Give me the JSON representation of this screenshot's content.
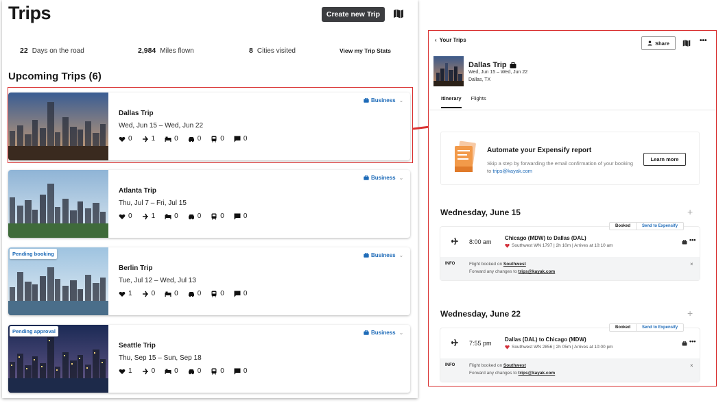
{
  "left": {
    "title": "Trips",
    "create_label": "Create new Trip",
    "stats": [
      {
        "value": "22",
        "label": "Days on the road"
      },
      {
        "value": "2,984",
        "label": "Miles flown"
      },
      {
        "value": "8",
        "label": "Cities visited"
      }
    ],
    "stats_link": "View my Trip Stats",
    "upcoming_title": "Upcoming Trips (6)",
    "trips": [
      {
        "name": "Dallas Trip",
        "dates": "Wed, Jun 15 – Wed, Jun 22",
        "tag": "Business",
        "badge": "",
        "counts": [
          "0",
          "1",
          "0",
          "0",
          "0",
          "0"
        ]
      },
      {
        "name": "Atlanta Trip",
        "dates": "Thu, Jul 7 – Fri, Jul 15",
        "tag": "Business",
        "badge": "",
        "counts": [
          "0",
          "1",
          "0",
          "0",
          "0",
          "0"
        ]
      },
      {
        "name": "Berlin Trip",
        "dates": "Tue, Jul 12 – Wed, Jul 13",
        "tag": "Business",
        "badge": "Pending booking",
        "counts": [
          "1",
          "0",
          "0",
          "0",
          "0",
          "0"
        ]
      },
      {
        "name": "Seattle Trip",
        "dates": "Thu, Sep 15 – Sun, Sep 18",
        "tag": "Business",
        "badge": "Pending approval",
        "counts": [
          "1",
          "0",
          "0",
          "0",
          "0",
          "0"
        ]
      }
    ]
  },
  "right": {
    "back_label": "Your Trips",
    "share_label": "Share",
    "trip_title": "Dallas Trip",
    "trip_dates": "Wed, Jun 15 – Wed, Jun 22",
    "trip_location": "Dallas, TX",
    "tabs": [
      "Itinerary",
      "Flights"
    ],
    "expensify": {
      "title": "Automate your Expensify report",
      "text": "Skip a step by forwarding the email confirmation of your booking to",
      "email": "trips@kayak.com",
      "button": "Learn more"
    },
    "days": [
      {
        "title": "Wednesday, June 15",
        "booked": "Booked",
        "send": "Send to Expensify",
        "time": "8:00 am",
        "route": "Chicago (MDW) to Dallas (DAL)",
        "detail": "Southwest WN 1797 | 2h 10m | Arrives at 10:10 am",
        "info_label": "INFO",
        "info_line1": "Flight booked on",
        "info_airline": "Southwest",
        "info_line2": "Forward any changes to",
        "info_email": "trips@kayak.com"
      },
      {
        "title": "Wednesday, June 22",
        "booked": "Booked",
        "send": "Send to Expensify",
        "time": "7:55 pm",
        "route": "Dallas (DAL) to Chicago (MDW)",
        "detail": "Southwest WN 2856 | 2h 05m | Arrives at 10:00 pm",
        "info_label": "INFO",
        "info_line1": "Flight booked on",
        "info_airline": "Southwest",
        "info_line2": "Forward any changes to",
        "info_email": "trips@kayak.com"
      }
    ]
  },
  "colors": {
    "accent": "#1e6bb8",
    "highlight": "#d93030",
    "dark_button": "#3c3d40"
  }
}
